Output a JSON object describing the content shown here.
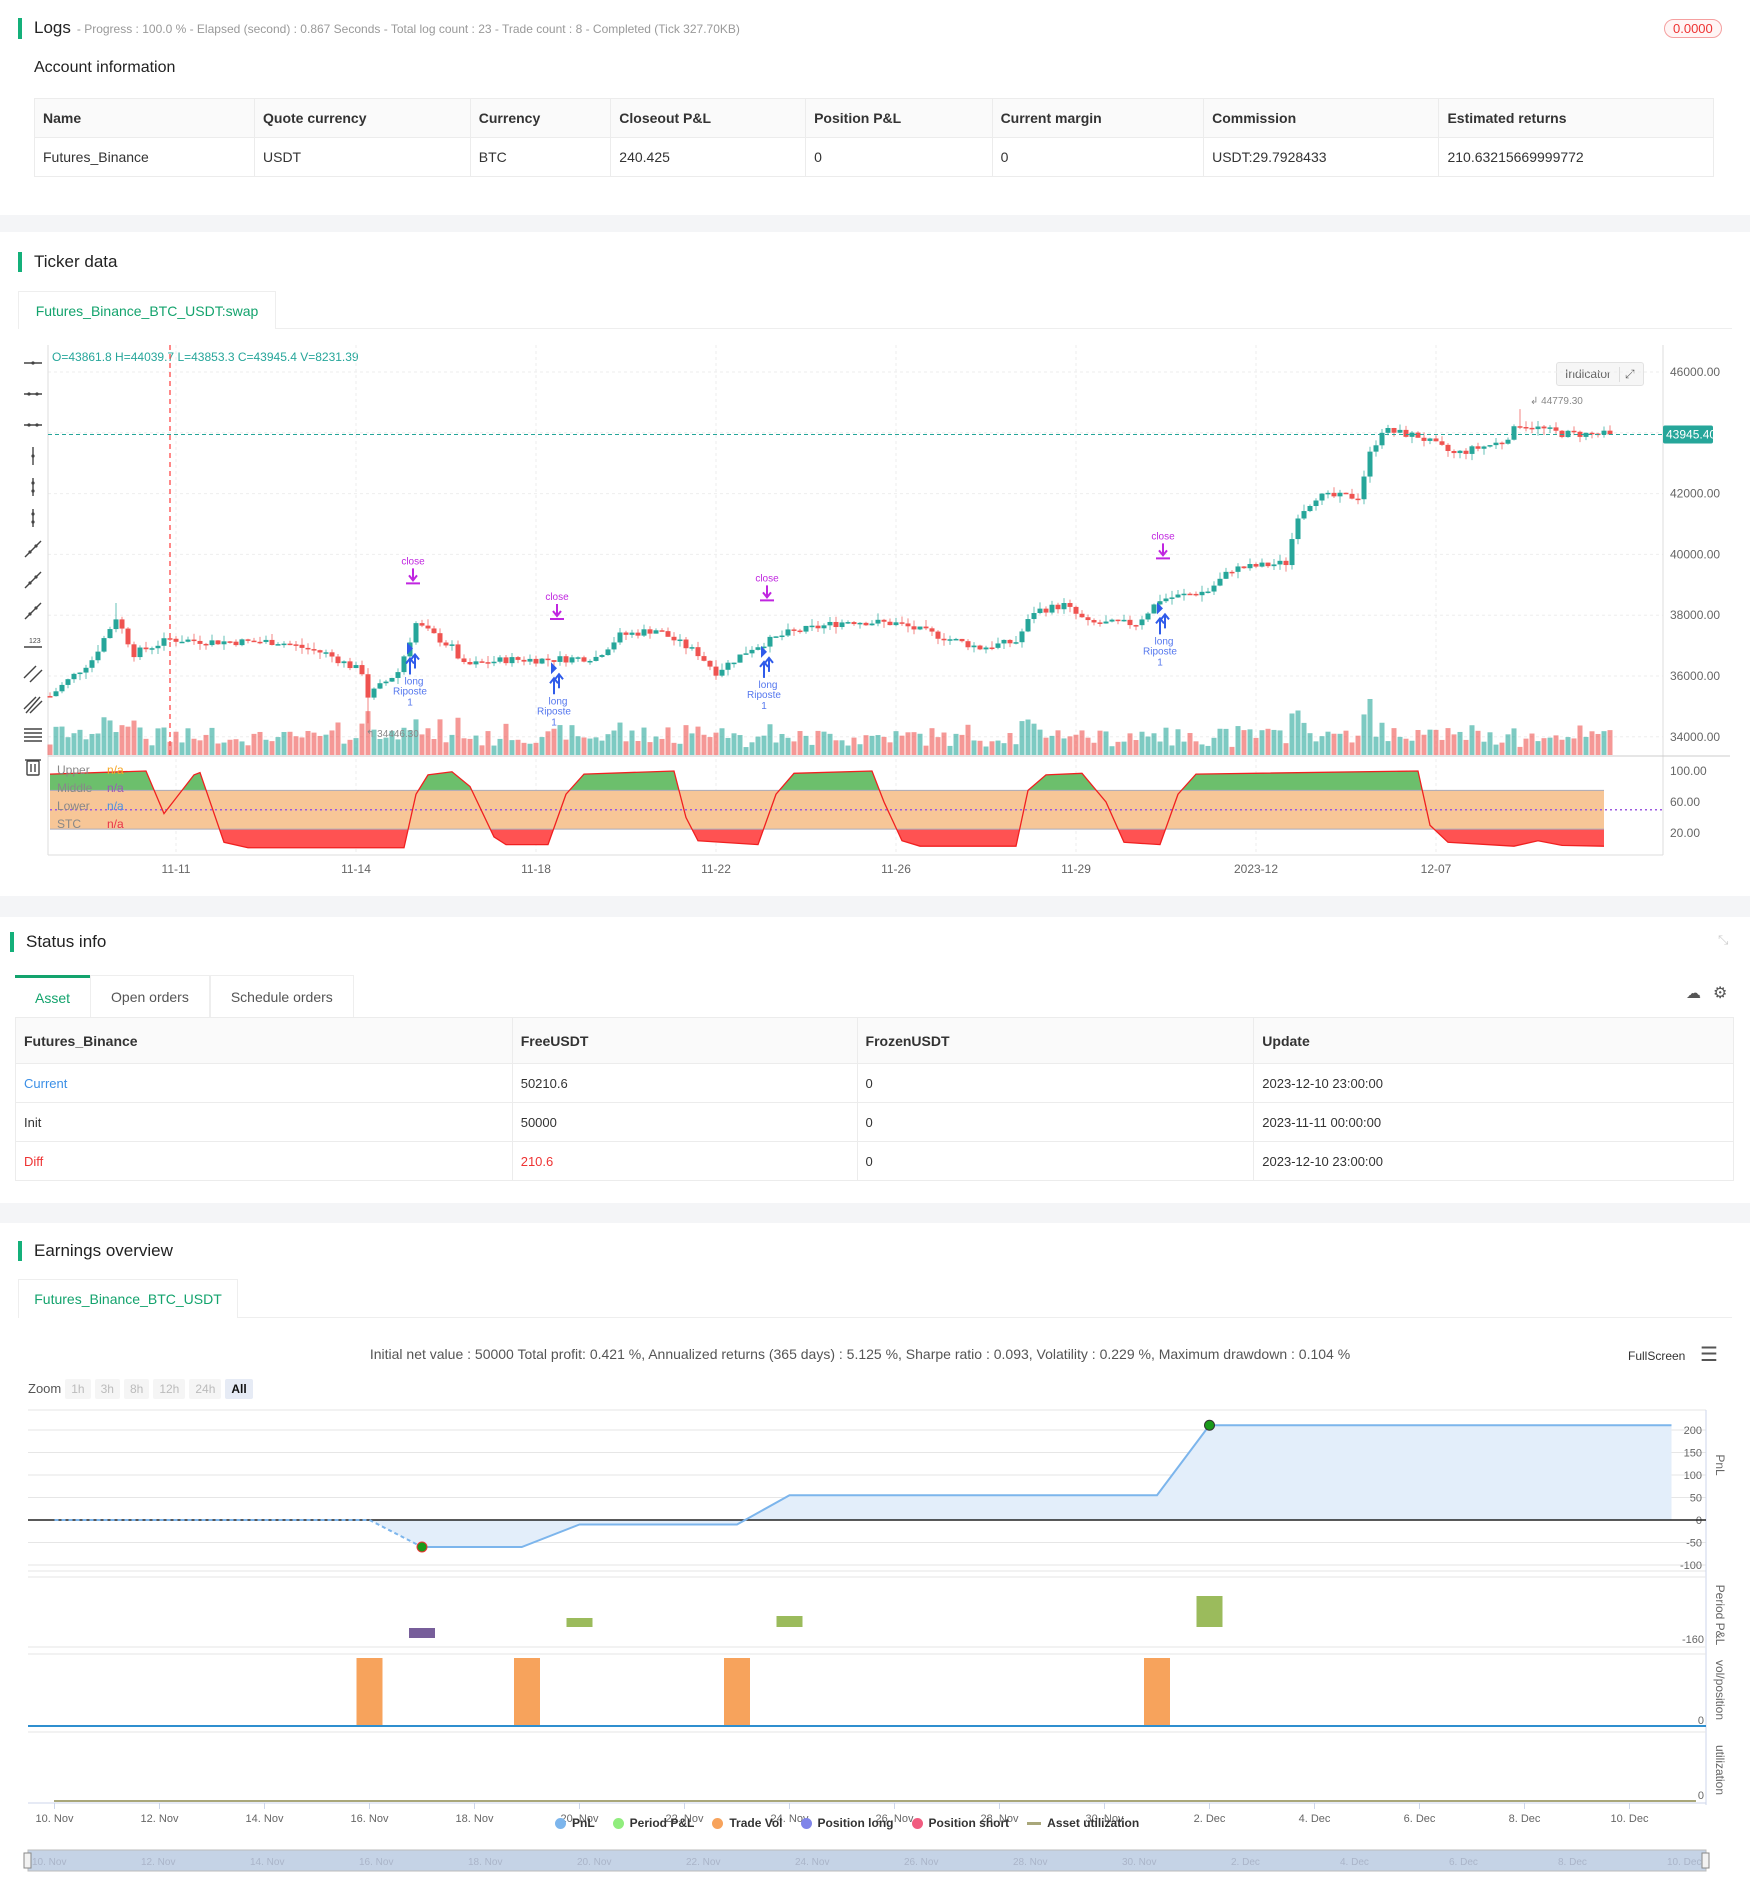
{
  "logs": {
    "title": "Logs",
    "subtitle": "- Progress : 100.0 % - Elapsed (second) : 0.867  Seconds - Total log count : 23 - Trade count : 8 - Completed (Tick 327.70KB)",
    "badge": "0.0000"
  },
  "account": {
    "title": "Account information",
    "headers": [
      "Name",
      "Quote currency",
      "Currency",
      "Closeout P&L",
      "Position P&L",
      "Current margin",
      "Commission",
      "Estimated returns"
    ],
    "row": [
      "Futures_Binance",
      "USDT",
      "BTC",
      "240.425",
      "0",
      "0",
      "USDT:29.7928433",
      "210.63215669999772"
    ]
  },
  "ticker": {
    "title": "Ticker data",
    "tab": "Futures_Binance_BTC_USDT:swap",
    "ohlc": "O=43861.8 H=44039.7 L=43853.3 C=43945.4 V=8231.39",
    "indicator_button": "Indicator",
    "current_price": "43945.40",
    "high_label": "44779.30",
    "low_label": "34446.30",
    "indicator_legend": [
      {
        "name": "Upper",
        "value": "n/a",
        "color": "#f5a623"
      },
      {
        "name": "Middle",
        "value": "n/a",
        "color": "#9b59b6"
      },
      {
        "name": "Lower",
        "value": "n/a",
        "color": "#4a90e2"
      },
      {
        "name": "STC",
        "value": "n/a",
        "color": "#e8334a"
      }
    ],
    "price_ticks": [
      "46000.00",
      "42000.00",
      "40000.00",
      "38000.00",
      "36000.00",
      "34000.00"
    ],
    "stc_ticks": [
      "100.00",
      "60.00",
      "20.00"
    ],
    "x_ticks": [
      {
        "i": 21,
        "label": "11-11"
      },
      {
        "i": 51,
        "label": "11-14"
      },
      {
        "i": 81,
        "label": "11-18"
      },
      {
        "i": 111,
        "label": "11-22"
      },
      {
        "i": 141,
        "label": "11-26"
      },
      {
        "i": 171,
        "label": "11-29"
      },
      {
        "i": 201,
        "label": "2023-12"
      },
      {
        "i": 231,
        "label": "12-07"
      }
    ],
    "price_waypoints": [
      [
        0,
        35340
      ],
      [
        7,
        36540
      ],
      [
        11,
        37930
      ],
      [
        14,
        36740
      ],
      [
        20,
        37210
      ],
      [
        27,
        37130
      ],
      [
        38,
        37130
      ],
      [
        46,
        36740
      ],
      [
        52,
        36140
      ],
      [
        53,
        35340
      ],
      [
        58,
        36140
      ],
      [
        61,
        37730
      ],
      [
        67,
        36930
      ],
      [
        69,
        36340
      ],
      [
        76,
        36540
      ],
      [
        83,
        36540
      ],
      [
        91,
        36620
      ],
      [
        95,
        37330
      ],
      [
        101,
        37530
      ],
      [
        108,
        36740
      ],
      [
        111,
        36140
      ],
      [
        117,
        36930
      ],
      [
        123,
        37410
      ],
      [
        133,
        37810
      ],
      [
        141,
        37730
      ],
      [
        148,
        37330
      ],
      [
        155,
        36930
      ],
      [
        161,
        37130
      ],
      [
        164,
        38130
      ],
      [
        169,
        38330
      ],
      [
        173,
        37730
      ],
      [
        181,
        37730
      ],
      [
        185,
        38520
      ],
      [
        193,
        38800
      ],
      [
        197,
        39520
      ],
      [
        206,
        39720
      ],
      [
        208,
        41310
      ],
      [
        211,
        41900
      ],
      [
        218,
        41900
      ],
      [
        220,
        43300
      ],
      [
        222,
        44090
      ],
      [
        228,
        43890
      ],
      [
        234,
        43300
      ],
      [
        242,
        43700
      ],
      [
        245,
        44290
      ],
      [
        252,
        43970
      ],
      [
        260,
        43945.4
      ]
    ],
    "stc_points": [
      [
        0,
        96
      ],
      [
        16,
        100
      ],
      [
        19,
        45
      ],
      [
        24,
        95
      ],
      [
        25,
        98
      ],
      [
        29,
        8
      ],
      [
        33,
        1
      ],
      [
        59,
        1
      ],
      [
        61,
        70
      ],
      [
        63,
        95
      ],
      [
        67,
        99
      ],
      [
        70,
        80
      ],
      [
        74,
        15
      ],
      [
        76,
        5
      ],
      [
        83,
        5
      ],
      [
        86,
        70
      ],
      [
        89,
        96
      ],
      [
        104,
        100
      ],
      [
        106,
        40
      ],
      [
        108,
        10
      ],
      [
        118,
        5
      ],
      [
        121,
        70
      ],
      [
        124,
        97
      ],
      [
        137,
        100
      ],
      [
        139,
        60
      ],
      [
        142,
        10
      ],
      [
        145,
        3
      ],
      [
        161,
        3
      ],
      [
        163,
        75
      ],
      [
        166,
        95
      ],
      [
        172,
        97
      ],
      [
        176,
        60
      ],
      [
        179,
        8
      ],
      [
        185,
        5
      ],
      [
        188,
        70
      ],
      [
        191,
        96
      ],
      [
        228,
        100
      ],
      [
        230,
        30
      ],
      [
        233,
        8
      ],
      [
        244,
        3
      ],
      [
        248,
        10
      ],
      [
        252,
        4
      ],
      [
        259,
        3
      ]
    ],
    "trades": [
      {
        "i": 60,
        "close_label": "close",
        "long_label": "long",
        "tag": "Riposte",
        "qty": "1"
      },
      {
        "i": 84,
        "close_label": "close",
        "long_label": "long",
        "tag": "Riposte",
        "qty": "1"
      },
      {
        "i": 119,
        "close_label": "close",
        "long_label": "long",
        "tag": "Riposte",
        "qty": "1"
      },
      {
        "i": 185,
        "close_label": "close",
        "long_label": "long",
        "tag": "Riposte",
        "qty": "1"
      }
    ],
    "colors": {
      "up": "#26a69a",
      "down": "#ef5350",
      "close": "#c026e0",
      "long": "#2f5bea"
    }
  },
  "status": {
    "title": "Status info",
    "tabs": [
      "Asset",
      "Open orders",
      "Schedule orders"
    ],
    "headers": [
      "Futures_Binance",
      "FreeUSDT",
      "FrozenUSDT",
      "Update"
    ],
    "rows": [
      [
        "Current",
        "50210.6",
        "0",
        "2023-12-10 23:00:00"
      ],
      [
        "Init",
        "50000",
        "0",
        "2023-11-11 00:00:00"
      ],
      [
        "Diff",
        "210.6",
        "0",
        "2023-12-10 23:00:00"
      ]
    ]
  },
  "earnings": {
    "title": "Earnings overview",
    "tab": "Futures_Binance_BTC_USDT",
    "summary": "Initial net value : 50000 Total profit: 0.421 %, Annualized returns (365 days) : 5.125 %, Sharpe ratio : 0.093, Volatility : 0.229 %, Maximum drawdown : 0.104 %",
    "fullscreen": "FullScreen",
    "zoom_label": "Zoom",
    "zoom_options": [
      "1h",
      "3h",
      "8h",
      "12h",
      "24h",
      "All"
    ],
    "axis_titles": [
      "PnL",
      "Period P&L",
      "vol/position",
      "utilization"
    ],
    "pnl_ticks": [
      200,
      150,
      100,
      50,
      0,
      -50,
      -100
    ],
    "period_tick": "-160",
    "zero_tick": "0",
    "x_labels": [
      "10. Nov",
      "12. Nov",
      "14. Nov",
      "16. Nov",
      "18. Nov",
      "20. Nov",
      "22. Nov",
      "24. Nov",
      "26. Nov",
      "28. Nov",
      "30. Nov",
      "2. Dec",
      "4. Dec",
      "6. Dec",
      "8. Dec",
      "10. Dec"
    ],
    "legend": [
      {
        "name": "PnL",
        "color": "#7cb5ec"
      },
      {
        "name": "Period P&L",
        "color": "#90ed7d"
      },
      {
        "name": "Trade Vol",
        "color": "#f7a35c"
      },
      {
        "name": "Position long",
        "color": "#8085e9"
      },
      {
        "name": "Position short",
        "color": "#f15c80"
      },
      {
        "name": "Asset utilization",
        "color": "#a9a77a"
      }
    ],
    "chart_data": {
      "type": "line",
      "pnl": [
        [
          0,
          0
        ],
        [
          6,
          0
        ],
        [
          7,
          -60
        ],
        [
          8.9,
          -60
        ],
        [
          10,
          -10
        ],
        [
          13,
          -10
        ],
        [
          14,
          55
        ],
        [
          21,
          55
        ],
        [
          22,
          210.6
        ],
        [
          30.8,
          210.6
        ]
      ],
      "period_pnl": [
        [
          7,
          -60
        ],
        [
          10,
          45
        ],
        [
          14,
          55
        ],
        [
          22,
          155
        ]
      ],
      "trade_vol": [
        6,
        9,
        13,
        21
      ]
    }
  }
}
